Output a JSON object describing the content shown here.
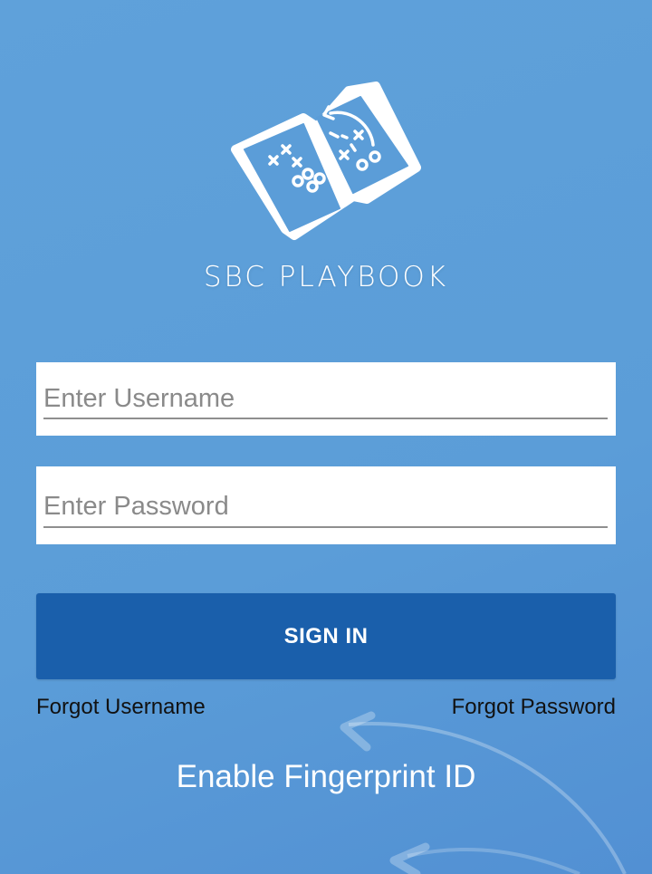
{
  "app": {
    "brand_name": "SBC PLAYBOOK",
    "logo_icon": "playbook-book-icon"
  },
  "form": {
    "username_placeholder": "Enter Username",
    "username_value": "",
    "password_placeholder": "Enter Password",
    "password_value": "",
    "signin_label": "SIGN IN"
  },
  "links": {
    "forgot_username": "Forgot Username",
    "forgot_password": "Forgot Password",
    "enable_fingerprint": "Enable Fingerprint ID"
  },
  "colors": {
    "background": "#5b9dd8",
    "button": "#1a5fab",
    "field_background": "#ffffff",
    "text_light": "#ffffff",
    "text_dark": "#111111"
  }
}
